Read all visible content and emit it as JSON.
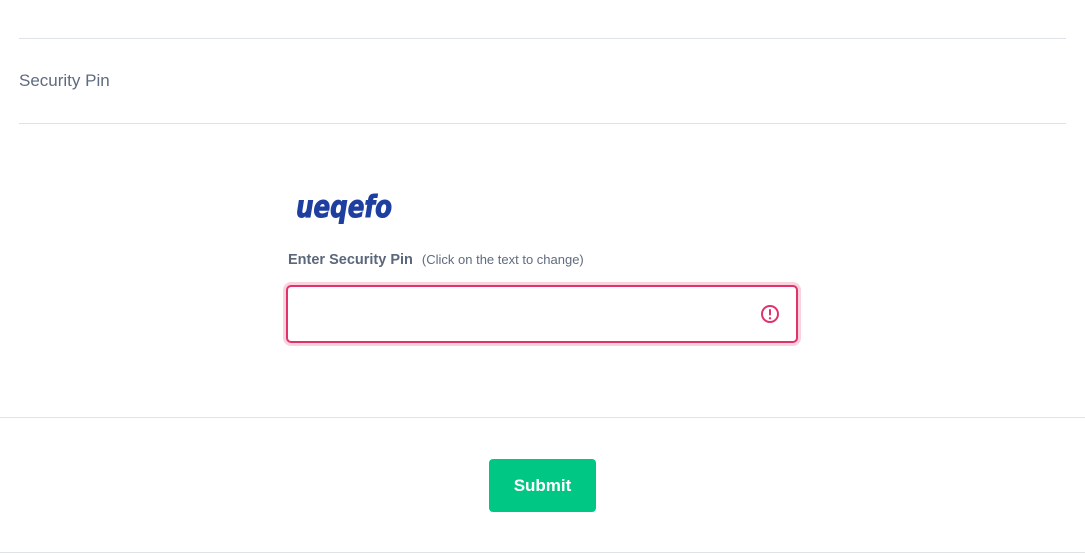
{
  "section": {
    "title": "Security Pin"
  },
  "captcha": {
    "text": "ueqefo",
    "color": "#1f3fa0"
  },
  "pin_field": {
    "label": "Enter Security Pin",
    "hint": "(Click on the text to change)",
    "value": "",
    "state": "invalid",
    "error_color": "#e0336b",
    "icon": "alert-circle-icon"
  },
  "actions": {
    "submit_label": "Submit",
    "submit_color": "#00c884"
  }
}
